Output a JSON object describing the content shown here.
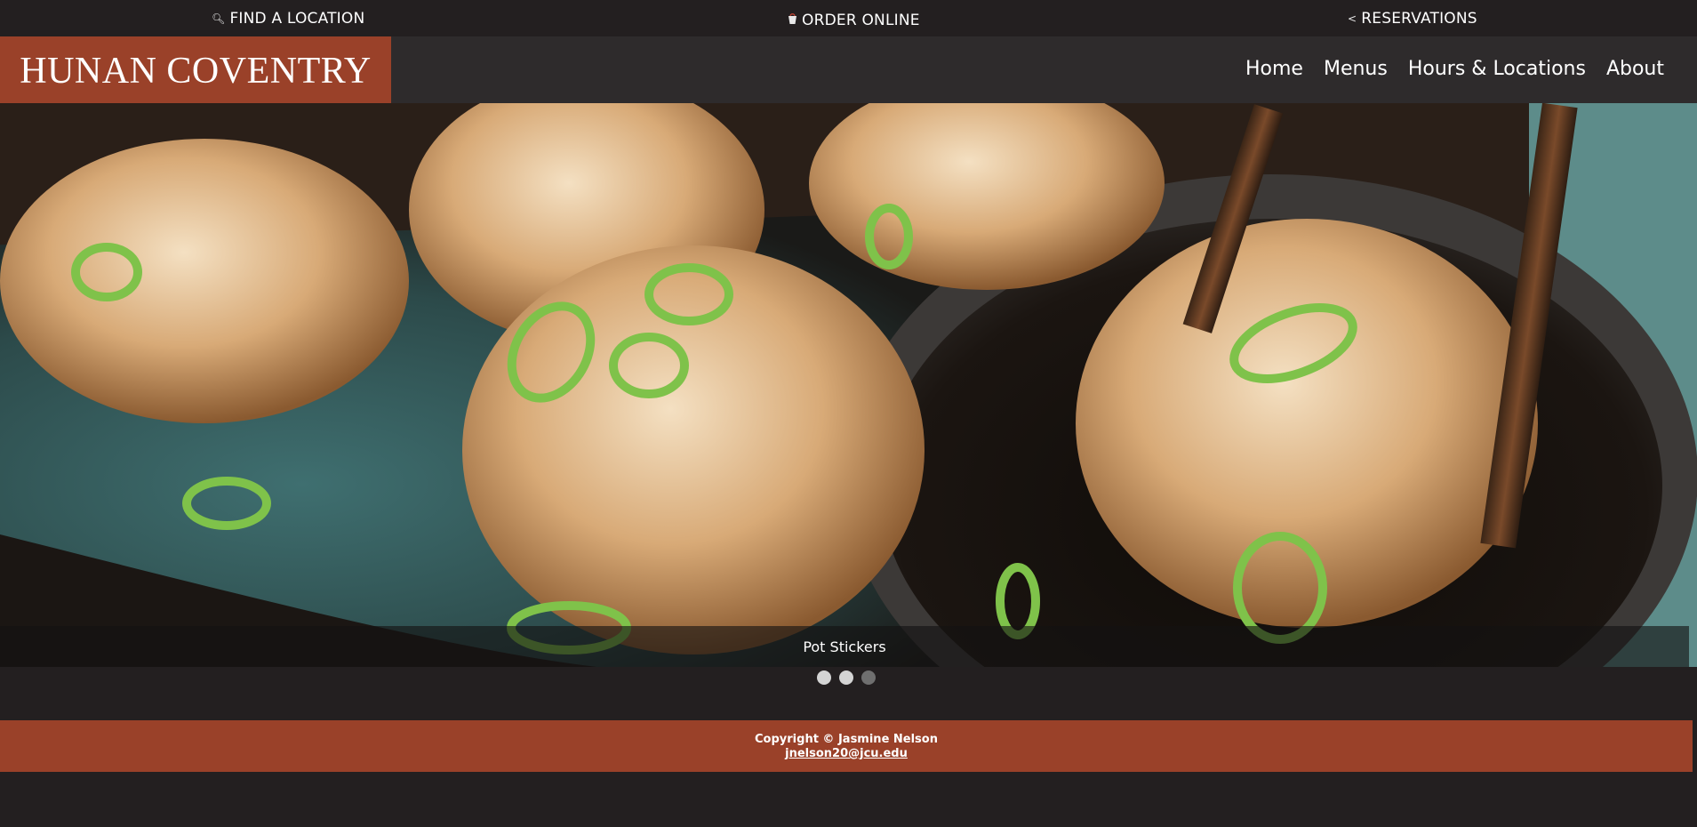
{
  "topbar": {
    "find_location": "FIND A LOCATION",
    "order_online": "ORDER ONLINE",
    "reservations": "RESERVATIONS"
  },
  "header": {
    "logo_text": "HUNAN COVENTRY",
    "nav": [
      "Home",
      "Menus",
      "Hours & Locations",
      "About"
    ]
  },
  "slider": {
    "caption": "Pot Stickers",
    "slide_count": 3,
    "active_slide": 3
  },
  "footer": {
    "copyright": "Copyright © Jasmine Nelson",
    "email": "jnelson20@jcu.edu"
  },
  "colors": {
    "brand": "#9a4129",
    "background": "#231f20",
    "header": "#2e2b2c"
  }
}
